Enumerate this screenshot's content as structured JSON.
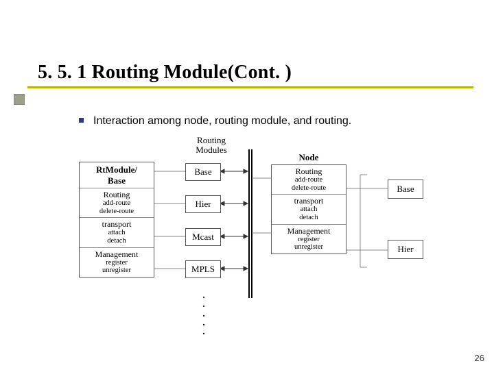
{
  "title": "5. 5. 1  Routing Module(Cont. )",
  "bullet_text": "Interaction among node, routing module, and routing.",
  "labels": {
    "routing_modules": "Routing\nModules",
    "node": "Node"
  },
  "left_stack": {
    "header": "RtModule/\nBase",
    "rows": [
      {
        "title": "Routing",
        "subs": [
          "add-route",
          "delete-route"
        ]
      },
      {
        "title": "transport",
        "subs": [
          "attach",
          "detach"
        ]
      },
      {
        "title": "Management",
        "subs": [
          "register",
          "unregister"
        ]
      }
    ]
  },
  "middle_boxes": [
    "Base",
    "Hier",
    "Mcast",
    "MPLS"
  ],
  "right_stack": {
    "rows": [
      {
        "title": "Routing",
        "subs": [
          "add-route",
          "delete-route"
        ]
      },
      {
        "title": "transport",
        "subs": [
          "attach",
          "detach"
        ]
      },
      {
        "title": "Management",
        "subs": [
          "register",
          "unregister"
        ]
      }
    ]
  },
  "right_side_boxes": [
    "Base",
    "Hier"
  ],
  "dots": ".\n.\n.\n.\n.",
  "page_number": "26"
}
